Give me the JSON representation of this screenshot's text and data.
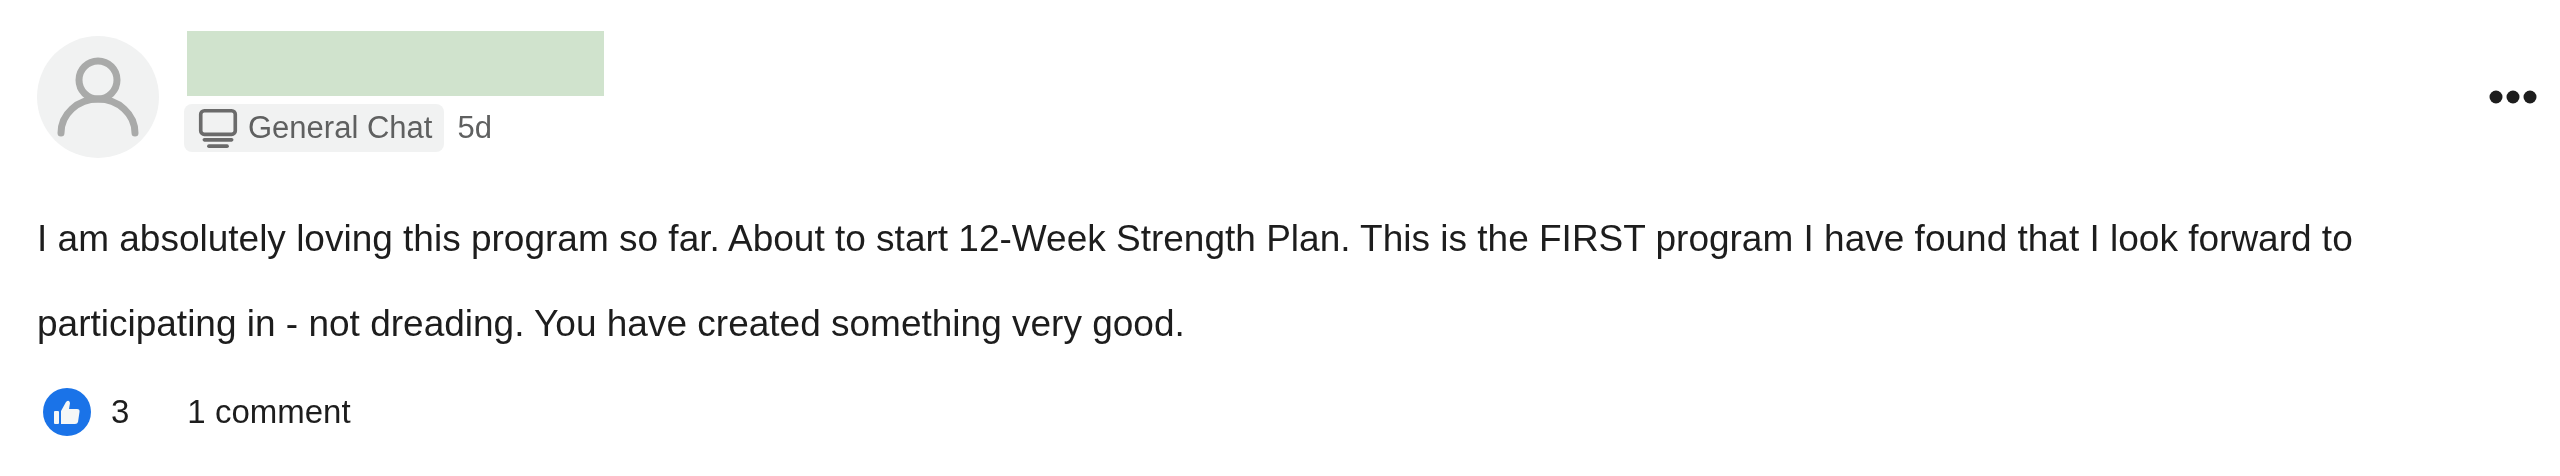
{
  "post": {
    "channel": "General Chat",
    "time": "5d",
    "body": "I am absolutely loving this program so far. About to start 12-Week Strength Plan. This is the FIRST program I have found that I look forward to participating in - not dreading. You have created something very good.",
    "likes": "3",
    "comments": "1 comment"
  }
}
